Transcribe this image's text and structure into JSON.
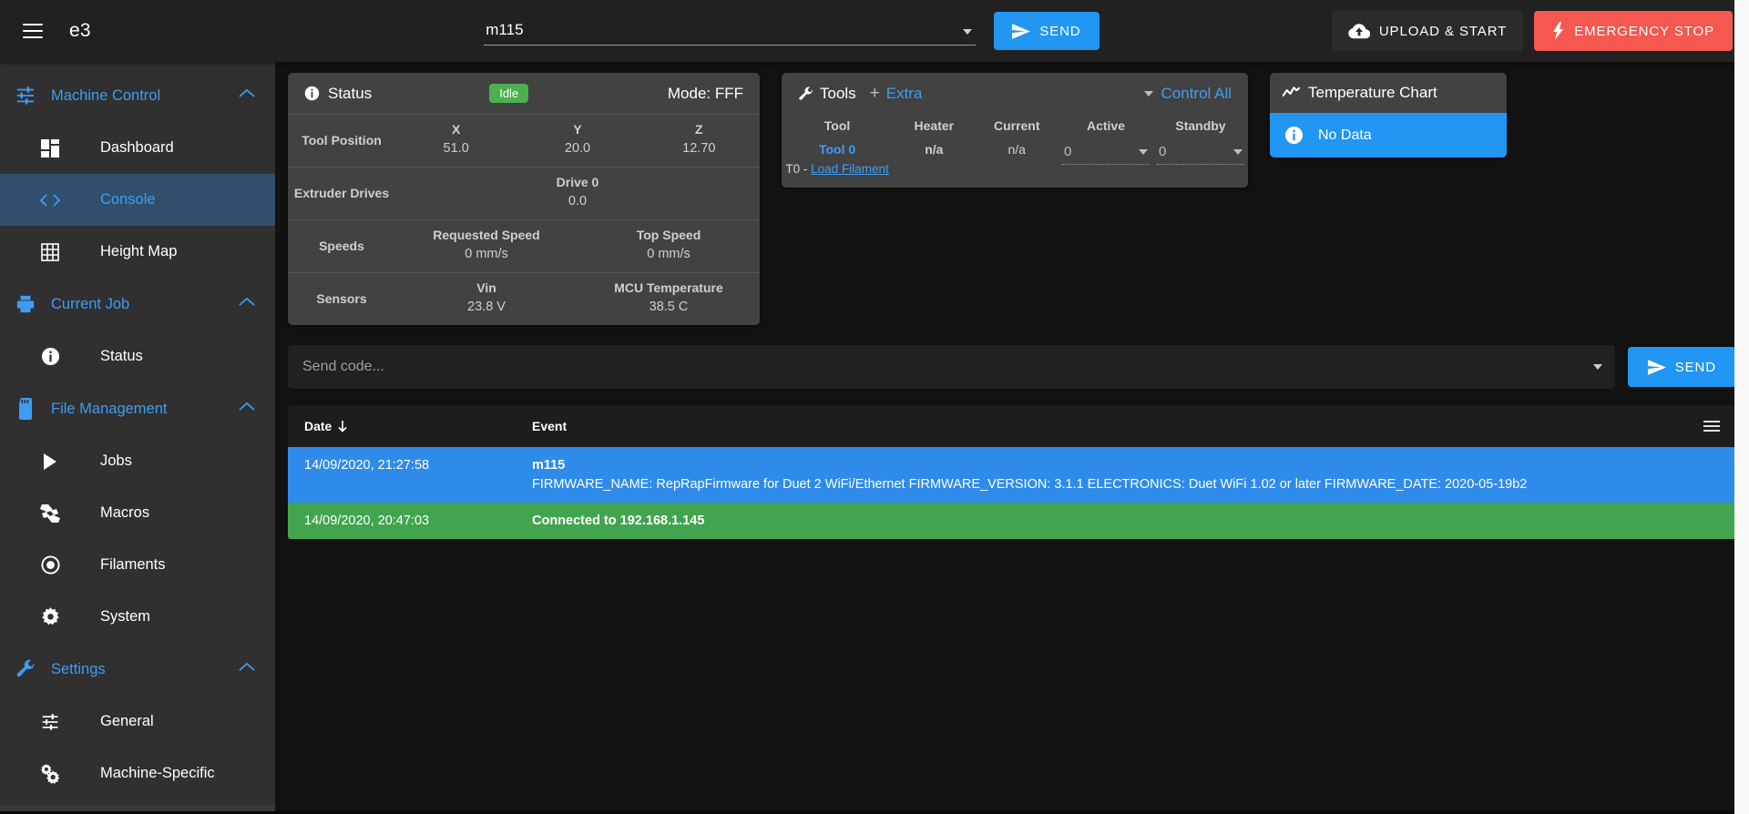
{
  "topbar": {
    "menu_icon": "hamburger-menu-icon",
    "brand": "e3",
    "code_input_value": "m115",
    "send_label": "SEND",
    "send_icon": "send-paper-plane-icon",
    "upload_label": "UPLOAD & START",
    "upload_icon": "cloud-upload-icon",
    "estop_label": "EMERGENCY STOP",
    "estop_icon": "lightning-bolt-icon",
    "accent": "#2196f3",
    "danger": "#f4584e"
  },
  "sidebar": {
    "groups": [
      {
        "label": "Machine Control",
        "icon": "sliders-icon",
        "chevron": "chevron-up-icon",
        "items": [
          {
            "label": "Dashboard",
            "icon": "dashboard-grid-icon",
            "active": false
          },
          {
            "label": "Console",
            "icon": "code-brackets-icon",
            "active": true
          },
          {
            "label": "Height Map",
            "icon": "grid-table-icon",
            "active": false
          }
        ]
      },
      {
        "label": "Current Job",
        "icon": "printer-icon",
        "chevron": "chevron-up-icon",
        "items": [
          {
            "label": "Status",
            "icon": "info-circle-icon",
            "active": false
          }
        ]
      },
      {
        "label": "File Management",
        "icon": "sd-card-icon",
        "chevron": "chevron-up-icon",
        "items": [
          {
            "label": "Jobs",
            "icon": "play-triangle-icon",
            "active": false
          },
          {
            "label": "Macros",
            "icon": "macro-s-icon",
            "active": false
          },
          {
            "label": "Filaments",
            "icon": "filament-spool-icon",
            "active": false
          },
          {
            "label": "System",
            "icon": "gear-icon",
            "active": false
          }
        ]
      },
      {
        "label": "Settings",
        "icon": "wrench-icon",
        "chevron": "chevron-up-icon",
        "items": [
          {
            "label": "General",
            "icon": "sliders-icon",
            "active": false
          },
          {
            "label": "Machine-Specific",
            "icon": "double-gear-icon",
            "active": false
          }
        ]
      }
    ]
  },
  "status_panel": {
    "icon": "info-circle-icon",
    "title": "Status",
    "badge": "Idle",
    "badge_color": "#4caf50",
    "mode": "Mode: FFF",
    "rows": [
      {
        "label": "Tool Position",
        "cells": [
          {
            "head": "X",
            "value": "51.0"
          },
          {
            "head": "Y",
            "value": "20.0"
          },
          {
            "head": "Z",
            "value": "12.70"
          }
        ]
      },
      {
        "label": "Extruder Drives",
        "cells": [
          {
            "head": "Drive 0",
            "value": "0.0"
          }
        ]
      },
      {
        "label": "Speeds",
        "cells": [
          {
            "head": "Requested Speed",
            "value": "0 mm/s"
          },
          {
            "head": "Top Speed",
            "value": "0 mm/s"
          }
        ]
      },
      {
        "label": "Sensors",
        "cells": [
          {
            "head": "Vin",
            "value": "23.8 V"
          },
          {
            "head": "MCU Temperature",
            "value": "38.5 C"
          }
        ]
      }
    ]
  },
  "tools_panel": {
    "icon": "wrench-icon",
    "title": "Tools",
    "plus": "+",
    "extra_label": "Extra",
    "control_all_label": "Control All",
    "control_all_caret": "caret-down-icon",
    "columns": [
      "Tool",
      "Heater",
      "Current",
      "Active",
      "Standby"
    ],
    "rows": [
      {
        "tool_name": "Tool 0",
        "tool_prefix": "T0 - ",
        "tool_link": "Load Filament",
        "heater": "n/a",
        "current": "n/a",
        "active": "0",
        "standby": "0"
      }
    ]
  },
  "chart_panel": {
    "icon": "chart-line-icon",
    "title": "Temperature Chart",
    "message_icon": "info-circle-icon",
    "message": "No Data",
    "message_bg": "#2196f3"
  },
  "chart_data": {
    "type": "line",
    "title": "Temperature Chart",
    "series": [],
    "x": [],
    "annotations": [
      "No Data"
    ],
    "xlabel": "",
    "ylabel": "",
    "grid": false,
    "legend": "none"
  },
  "send_row": {
    "placeholder": "Send code...",
    "value": "",
    "caret": "caret-down-icon",
    "send_label": "SEND",
    "send_icon": "send-paper-plane-icon"
  },
  "log": {
    "columns": {
      "date": "Date",
      "date_sort_icon": "arrow-down-icon",
      "event": "Event",
      "menu_icon": "list-menu-icon"
    },
    "rows": [
      {
        "date": "14/09/2020, 21:27:58",
        "title": "m115",
        "body": "FIRMWARE_NAME: RepRapFirmware for Duet 2 WiFi/Ethernet FIRMWARE_VERSION: 3.1.1 ELECTRONICS: Duet WiFi 1.02 or later FIRMWARE_DATE: 2020-05-19b2",
        "style": "blue"
      },
      {
        "date": "14/09/2020, 20:47:03",
        "title": "Connected to 192.168.1.145",
        "body": "",
        "style": "green"
      }
    ]
  }
}
